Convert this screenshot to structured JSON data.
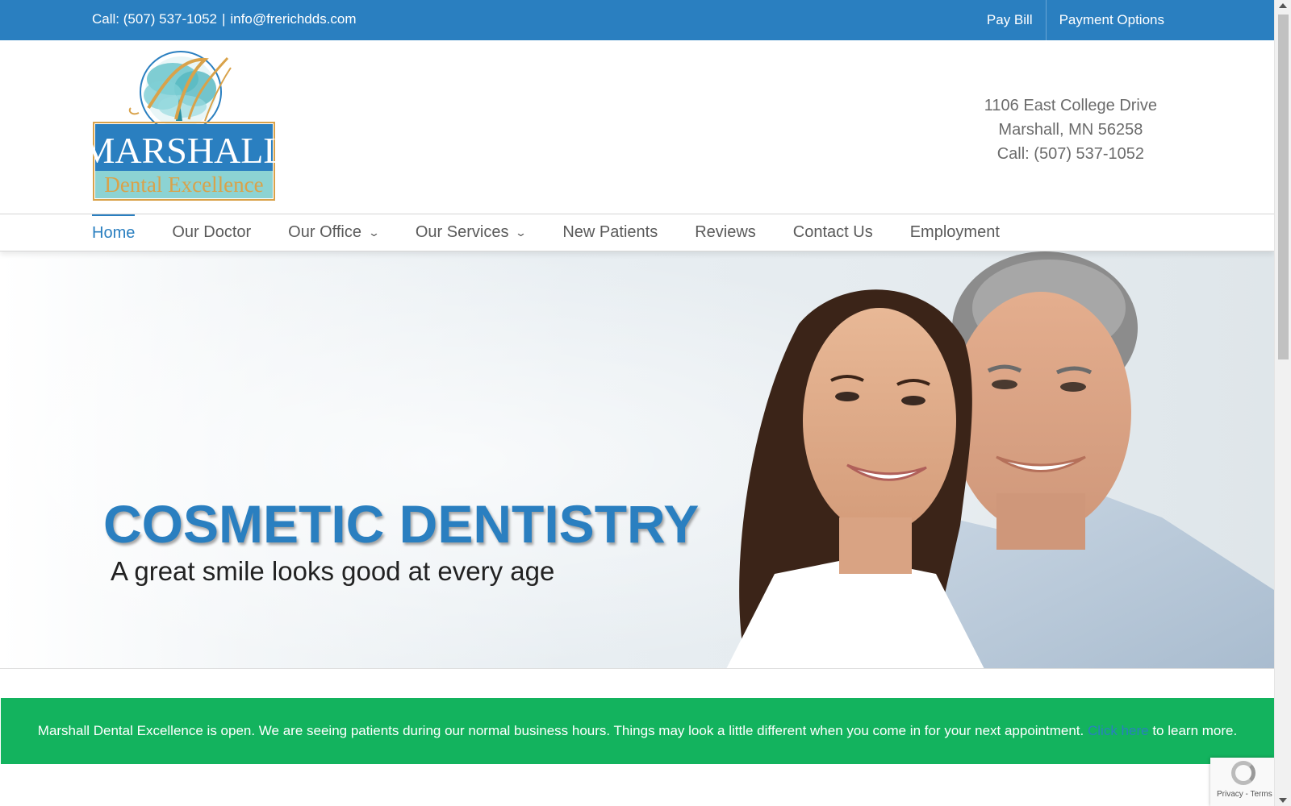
{
  "topbar": {
    "call": "Call: (507) 537-1052",
    "separator": "|",
    "email": "info@frerichdds.com",
    "links": [
      "Pay Bill",
      "Payment Options"
    ]
  },
  "logo": {
    "line1": "MARSHALL",
    "line2": "Dental Excellence",
    "monogram": "M"
  },
  "address": {
    "street": "1106 East College Drive",
    "city": "Marshall, MN 56258",
    "phone": "Call: (507) 537-1052"
  },
  "nav": {
    "items": [
      {
        "label": "Home",
        "active": true,
        "dropdown": false
      },
      {
        "label": "Our Doctor",
        "active": false,
        "dropdown": false
      },
      {
        "label": "Our Office",
        "active": false,
        "dropdown": true
      },
      {
        "label": "Our Services",
        "active": false,
        "dropdown": true
      },
      {
        "label": "New Patients",
        "active": false,
        "dropdown": false
      },
      {
        "label": "Reviews",
        "active": false,
        "dropdown": false
      },
      {
        "label": "Contact Us",
        "active": false,
        "dropdown": false
      },
      {
        "label": "Employment",
        "active": false,
        "dropdown": false
      }
    ]
  },
  "hero": {
    "title": "COSMETIC DENTISTRY",
    "subtitle": "A great smile looks good at every age"
  },
  "notice": {
    "text": "Marshall Dental Excellence is open. We are seeing patients during our normal business hours. Things may look a little different when you come in for your next appointment.",
    "link": "Click here",
    "after": "to learn more."
  },
  "recaptcha": {
    "text": "Privacy - Terms"
  },
  "colors": {
    "brand_blue": "#2a7fc0",
    "notice_green": "#13b35e",
    "nav_text": "#5a5a5a"
  }
}
